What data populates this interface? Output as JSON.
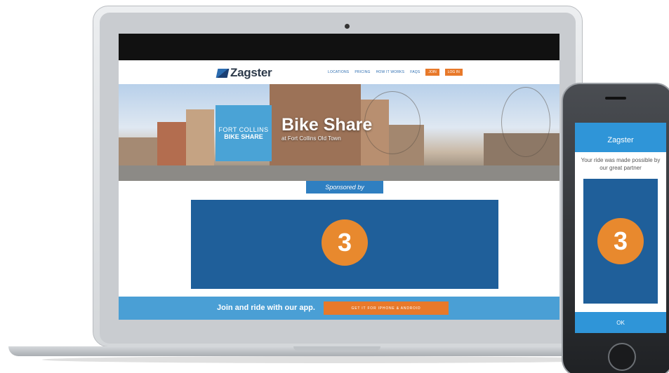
{
  "site": {
    "logo_text": "Zagster",
    "logo_sub": "",
    "nav": [
      "LOCATIONS",
      "PRICING",
      "HOW IT WORKS",
      "FAQS"
    ],
    "nav_buttons": [
      "JOIN",
      "LOG IN"
    ]
  },
  "hero": {
    "box_line1": "FORT COLLINS",
    "box_line2": "BIKE SHARE",
    "title": "Bike Share",
    "subtitle": "at Fort Collins Old Town"
  },
  "sponsor": {
    "label": "Sponsored by",
    "number": "3"
  },
  "footer": {
    "join_text": "Join and ride with our app.",
    "cta": "GET IT FOR IPHONE & ANDROID"
  },
  "phone": {
    "header": "Zagster",
    "message": "Your ride was made possible by our great partner",
    "number": "3",
    "ok": "OK"
  },
  "colors": {
    "brand_blue": "#2f95d8",
    "panel_blue": "#1f5f9a",
    "accent_orange": "#e8792a"
  }
}
